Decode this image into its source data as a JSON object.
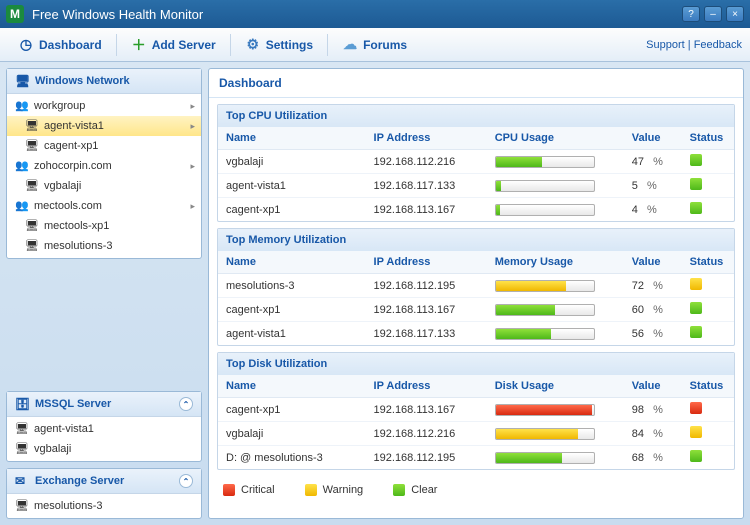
{
  "window": {
    "title": "Free Windows Health Monitor"
  },
  "toolbar": {
    "dashboard": "Dashboard",
    "addserver": "Add Server",
    "settings": "Settings",
    "forums": "Forums",
    "support": "Support",
    "feedback": "Feedback"
  },
  "sidebar": {
    "network": {
      "title": "Windows Network",
      "tree": [
        {
          "label": "workgroup",
          "level": 0,
          "icon": "group",
          "arrow": true,
          "sel": false
        },
        {
          "label": "agent-vista1",
          "level": 1,
          "icon": "pc",
          "arrow": true,
          "sel": true
        },
        {
          "label": "cagent-xp1",
          "level": 1,
          "icon": "pc",
          "arrow": false,
          "sel": false
        },
        {
          "label": "zohocorpin.com",
          "level": 0,
          "icon": "group",
          "arrow": true,
          "sel": false
        },
        {
          "label": "vgbalaji",
          "level": 1,
          "icon": "pc",
          "arrow": false,
          "sel": false
        },
        {
          "label": "mectools.com",
          "level": 0,
          "icon": "group",
          "arrow": true,
          "sel": false
        },
        {
          "label": "mectools-xp1",
          "level": 1,
          "icon": "pc",
          "arrow": false,
          "sel": false
        },
        {
          "label": "mesolutions-3",
          "level": 1,
          "icon": "pc",
          "arrow": false,
          "sel": false
        }
      ]
    },
    "mssql": {
      "title": "MSSQL Server",
      "items": [
        "agent-vista1",
        "vgbalaji"
      ]
    },
    "exchange": {
      "title": "Exchange Server",
      "items": [
        "mesolutions-3"
      ]
    }
  },
  "dashboard": {
    "title": "Dashboard",
    "headers": {
      "name": "Name",
      "ip": "IP Address",
      "value": "Value",
      "status": "Status"
    },
    "pct": "%",
    "cpu": {
      "title": "Top CPU Utilization",
      "usage_hdr": "CPU Usage",
      "rows": [
        {
          "name": "vgbalaji",
          "ip": "192.168.112.216",
          "value": 47,
          "status": "green"
        },
        {
          "name": "agent-vista1",
          "ip": "192.168.117.133",
          "value": 5,
          "status": "green"
        },
        {
          "name": "cagent-xp1",
          "ip": "192.168.113.167",
          "value": 4,
          "status": "green"
        }
      ]
    },
    "mem": {
      "title": "Top Memory Utilization",
      "usage_hdr": "Memory Usage",
      "rows": [
        {
          "name": "mesolutions-3",
          "ip": "192.168.112.195",
          "value": 72,
          "status": "yellow"
        },
        {
          "name": "cagent-xp1",
          "ip": "192.168.113.167",
          "value": 60,
          "status": "green"
        },
        {
          "name": "agent-vista1",
          "ip": "192.168.117.133",
          "value": 56,
          "status": "green"
        }
      ]
    },
    "disk": {
      "title": "Top Disk Utilization",
      "usage_hdr": "Disk Usage",
      "rows": [
        {
          "name": "cagent-xp1",
          "ip": "192.168.113.167",
          "value": 98,
          "status": "red"
        },
        {
          "name": "vgbalaji",
          "ip": "192.168.112.216",
          "value": 84,
          "status": "yellow"
        },
        {
          "name": "D: @ mesolutions-3",
          "ip": "192.168.112.195",
          "value": 68,
          "status": "green"
        }
      ]
    },
    "legend": {
      "critical": "Critical",
      "warning": "Warning",
      "clear": "Clear"
    }
  }
}
